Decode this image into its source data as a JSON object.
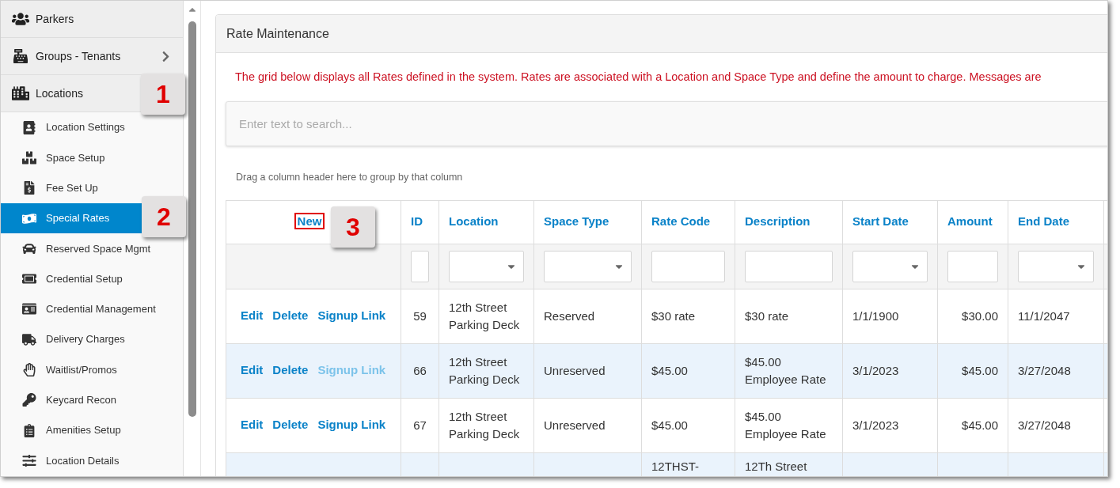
{
  "sidebar": {
    "sections": [
      {
        "label": "Parkers"
      },
      {
        "label": "Groups - Tenants",
        "chevron": true
      },
      {
        "label": "Locations"
      }
    ],
    "items": [
      {
        "label": "Location Settings",
        "selected": false
      },
      {
        "label": "Space Setup",
        "selected": false
      },
      {
        "label": "Fee Set Up",
        "selected": false
      },
      {
        "label": "Special Rates",
        "selected": true
      },
      {
        "label": "Reserved Space Mgmt",
        "selected": false
      },
      {
        "label": "Credential Setup",
        "selected": false
      },
      {
        "label": "Credential Management",
        "selected": false
      },
      {
        "label": "Delivery Charges",
        "selected": false
      },
      {
        "label": "Waitlist/Promos",
        "selected": false
      },
      {
        "label": "Keycard Recon",
        "selected": false
      },
      {
        "label": "Amenities Setup",
        "selected": false
      },
      {
        "label": "Location Details",
        "selected": false
      }
    ]
  },
  "panel": {
    "title": "Rate Maintenance",
    "message": "The grid below displays all Rates defined in the system. Rates are associated with a Location and Space Type and define the amount to charge. Messages are",
    "search": {
      "placeholder": "Enter text to search..."
    },
    "group_hint": "Drag a column header here to group by that column"
  },
  "table": {
    "new_link": {
      "label": "New",
      "highlighted": true
    },
    "columns": [
      {
        "label": "ID",
        "kind": "text"
      },
      {
        "label": "Location",
        "kind": "dropdown"
      },
      {
        "label": "Space Type",
        "kind": "dropdown"
      },
      {
        "label": "Rate Code",
        "kind": "text"
      },
      {
        "label": "Description",
        "kind": "text"
      },
      {
        "label": "Start Date",
        "kind": "dropdown"
      },
      {
        "label": "Amount",
        "kind": "text"
      },
      {
        "label": "End Date",
        "kind": "dropdown"
      }
    ],
    "rows": [
      {
        "actions": [
          {
            "label": "Edit",
            "disabled": false
          },
          {
            "label": "Delete",
            "disabled": false
          },
          {
            "label": "Signup Link",
            "disabled": false
          }
        ],
        "cells": [
          "59",
          "12th Street Parking Deck",
          "Reserved",
          "$30 rate",
          "$30 rate",
          "1/1/1900",
          "$30.00",
          "11/1/2047"
        ]
      },
      {
        "actions": [
          {
            "label": "Edit",
            "disabled": false
          },
          {
            "label": "Delete",
            "disabled": false
          },
          {
            "label": "Signup Link",
            "disabled": true
          }
        ],
        "cells": [
          "66",
          "12th Street Parking Deck",
          "Unreserved",
          "$45.00",
          "$45.00 Employee Rate",
          "3/1/2023",
          "$45.00",
          "3/27/2048"
        ]
      },
      {
        "actions": [
          {
            "label": "Edit",
            "disabled": false
          },
          {
            "label": "Delete",
            "disabled": false
          },
          {
            "label": "Signup Link",
            "disabled": false
          }
        ],
        "cells": [
          "67",
          "12th Street Parking Deck",
          "Unreserved",
          "$45.00",
          "$45.00 Employee Rate",
          "3/1/2023",
          "$45.00",
          "3/27/2048"
        ]
      },
      {
        "actions": [],
        "cells": [
          "",
          "",
          "",
          "12THST-",
          "12Th Street",
          "",
          "",
          ""
        ]
      }
    ]
  },
  "callouts": [
    "1",
    "2",
    "3"
  ]
}
